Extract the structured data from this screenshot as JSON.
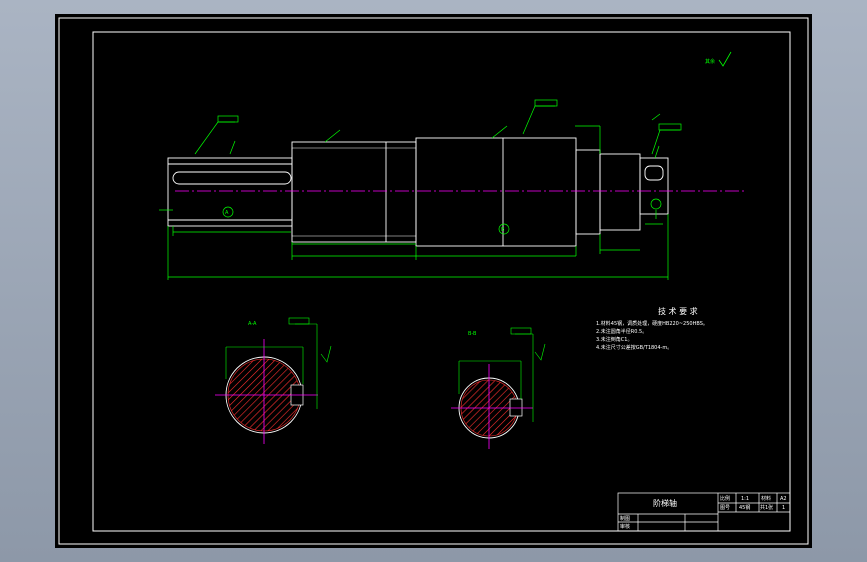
{
  "drawing": {
    "title_block": {
      "part_name": "阶梯轴",
      "cells": [
        "比例",
        "1:1",
        "材料",
        "A2",
        "图号",
        "45钢",
        "共1张",
        "1",
        "制图",
        "审核"
      ]
    },
    "tech_requirements": {
      "heading": "技 术 要 求",
      "items": [
        "1.材料45钢，调质处理，硬度HB220~250HBS。",
        "2.未注圆角半径R0.5。",
        "3.未注倒角C1。",
        "4.未注尺寸公差按GB/T1804-m。"
      ]
    },
    "labels": {
      "section_a": "A-A",
      "section_b": "B-B",
      "mark_a": "A",
      "mark_b": "B",
      "roughness_other": "其余"
    },
    "colors": {
      "outline": "#ffffff",
      "dimension": "#00ff00",
      "centerline": "#ff00ff",
      "hatch": "#ff3030",
      "frame": "#ffffff"
    }
  }
}
